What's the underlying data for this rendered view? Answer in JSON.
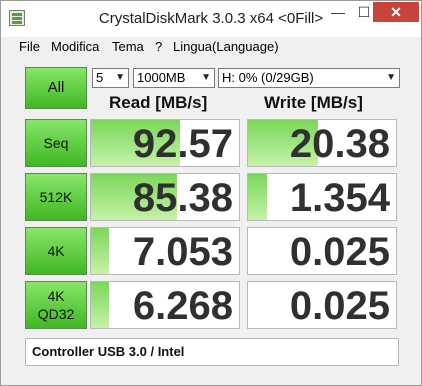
{
  "window": {
    "title": "CrystalDiskMark 3.0.3 x64 <0Fill>"
  },
  "titlebar": {
    "min": "—",
    "max": "☐",
    "close": "✕"
  },
  "menu": {
    "items": [
      "File",
      "Modifica",
      "Tema",
      "?",
      "Lingua(Language)"
    ]
  },
  "controls": {
    "all_label": "All",
    "count": "5",
    "size": "1000MB",
    "drive": "H: 0% (0/29GB)"
  },
  "headers": {
    "read": "Read [MB/s]",
    "write": "Write [MB/s]"
  },
  "tests": [
    {
      "label": "Seq",
      "label2": "",
      "read": "92.57",
      "write": "20.38",
      "read_level": 0.6,
      "write_level": 0.47
    },
    {
      "label": "512K",
      "label2": "",
      "read": "85.38",
      "write": "1.354",
      "read_level": 0.58,
      "write_level": 0.13
    },
    {
      "label": "4K",
      "label2": "",
      "read": "7.053",
      "write": "0.025",
      "read_level": 0.12,
      "write_level": 0.0
    },
    {
      "label": "4K",
      "label2": "QD32",
      "read": "6.268",
      "write": "0.025",
      "read_level": 0.12,
      "write_level": 0.0
    }
  ],
  "status": "Controller USB 3.0 / Intel",
  "colors": {
    "button_green": "#40b822",
    "bar_green": "#7ad75a",
    "close_red": "#c7433b"
  }
}
